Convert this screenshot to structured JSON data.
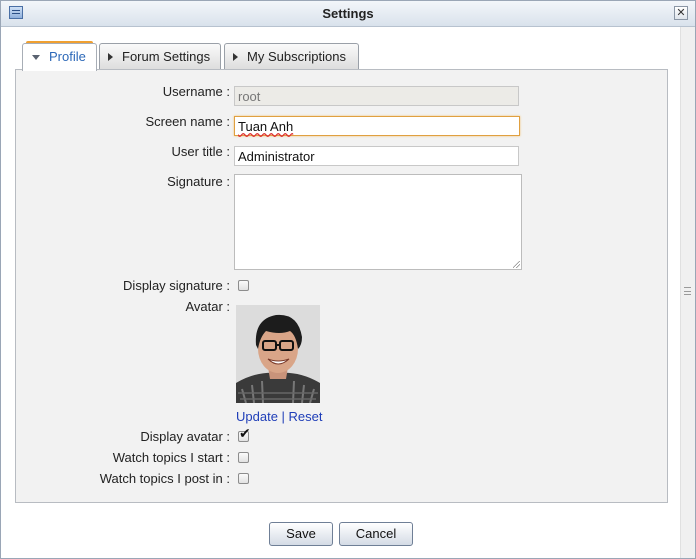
{
  "window": {
    "title": "Settings"
  },
  "tabs": [
    {
      "label": "Profile"
    },
    {
      "label": "Forum Settings"
    },
    {
      "label": "My Subscriptions"
    }
  ],
  "form": {
    "username_label": "Username :",
    "username_value": "root",
    "screen_name_label": "Screen name :",
    "screen_name_value": "Tuan Anh",
    "user_title_label": "User title :",
    "user_title_value": "Administrator",
    "signature_label": "Signature :",
    "signature_value": "",
    "display_signature_label": "Display signature :",
    "display_signature_checked": false,
    "avatar_label": "Avatar :",
    "avatar_update": "Update",
    "avatar_separator": " | ",
    "avatar_reset": "Reset",
    "display_avatar_label": "Display avatar :",
    "display_avatar_checked": true,
    "watch_start_label": "Watch topics I start :",
    "watch_start_checked": false,
    "watch_post_label": "Watch topics I post in :",
    "watch_post_checked": false
  },
  "buttons": {
    "save": "Save",
    "cancel": "Cancel"
  },
  "colors": {
    "accent_tab": "#f0a030",
    "link": "#1f3eb8",
    "active_tab_text": "#2c68b8"
  }
}
